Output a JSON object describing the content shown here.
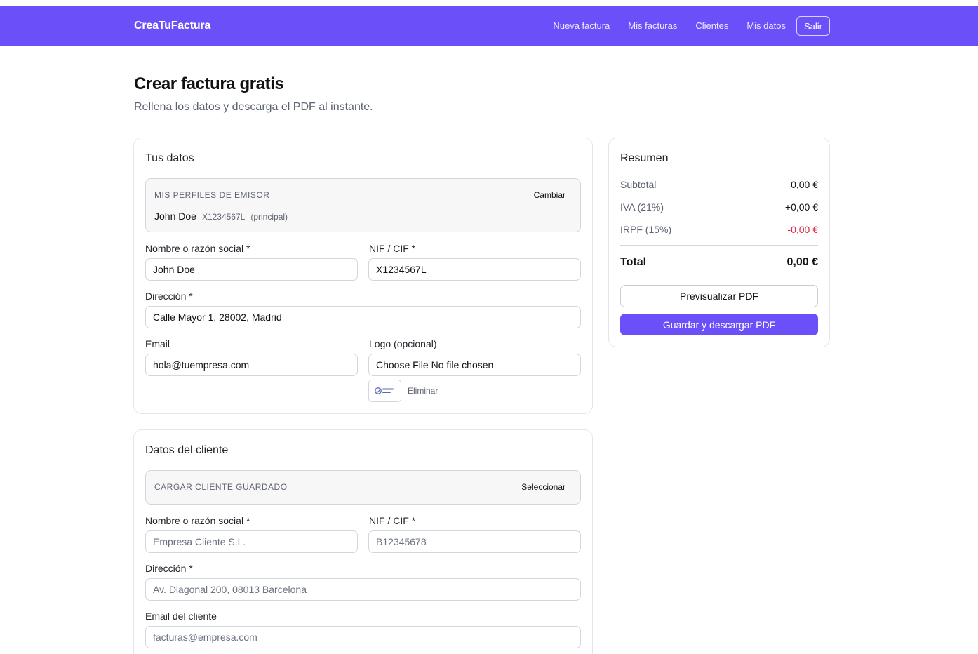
{
  "brand": "CreaTuFactura",
  "nav": {
    "items": [
      "Nueva factura",
      "Mis facturas",
      "Clientes",
      "Mis datos"
    ],
    "logout": "Salir"
  },
  "page": {
    "title": "Crear factura gratis",
    "subtitle": "Rellena los datos y descarga el PDF al instante."
  },
  "emisor": {
    "title": "Tus datos",
    "profiles_label": "MIS PERFILES DE EMISOR",
    "profiles_action": "Cambiar",
    "profile_name": "John Doe",
    "profile_nif": "X1234567L",
    "profile_tag": "(principal)",
    "name_label": "Nombre o razón social *",
    "name_value": "John Doe",
    "nif_label": "NIF / CIF *",
    "nif_value": "X1234567L",
    "address_label": "Dirección *",
    "address_value": "Calle Mayor 1, 28002, Madrid",
    "email_label": "Email",
    "email_value": "hola@tuempresa.com",
    "logo_label": "Logo (opcional)",
    "logo_file_text": "Choose File No file chosen",
    "logo_thumb_text": "Crea Tu Factura",
    "logo_remove": "Eliminar"
  },
  "cliente": {
    "title": "Datos del cliente",
    "saved_label": "CARGAR CLIENTE GUARDADO",
    "saved_action": "Seleccionar",
    "name_label": "Nombre o razón social *",
    "name_placeholder": "Empresa Cliente S.L.",
    "nif_label": "NIF / CIF *",
    "nif_placeholder": "B12345678",
    "address_label": "Dirección *",
    "address_placeholder": "Av. Diagonal 200, 08013 Barcelona",
    "email_label": "Email del cliente",
    "email_placeholder": "facturas@empresa.com"
  },
  "summary": {
    "title": "Resumen",
    "subtotal_label": "Subtotal",
    "subtotal_value": "0,00 €",
    "iva_label": "IVA (21%)",
    "iva_value": "+0,00 €",
    "irpf_label": "IRPF (15%)",
    "irpf_value": "-0,00 €",
    "total_label": "Total",
    "total_value": "0,00 €",
    "preview_button": "Previsualizar PDF",
    "save_button": "Guardar y descargar PDF"
  },
  "colors": {
    "accent": "#6b4ff8",
    "negative": "#dc2645"
  }
}
